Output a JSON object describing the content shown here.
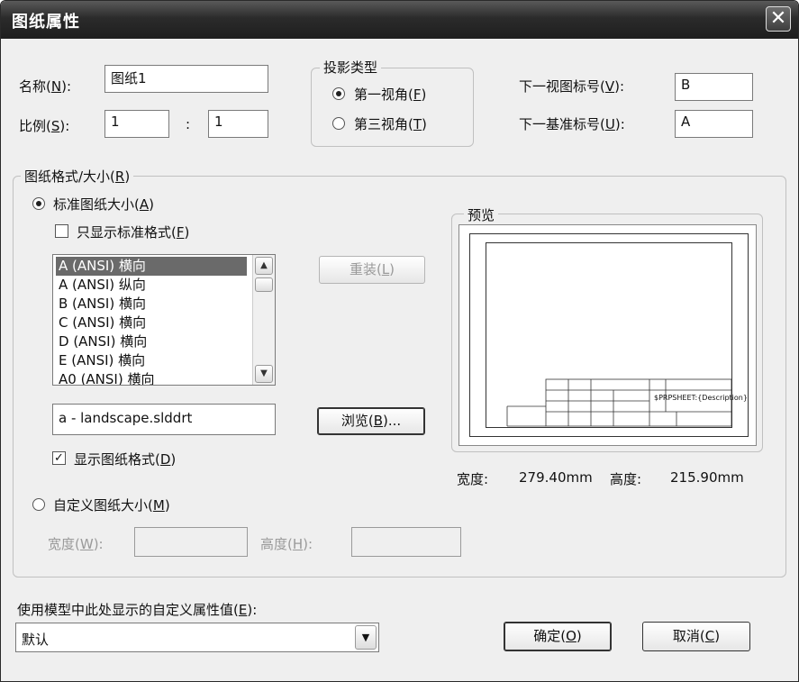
{
  "window": {
    "title": "图纸属性",
    "close_glyph": "✕"
  },
  "name": {
    "label": "名称(",
    "mnemonic": "N",
    "label_end": "):",
    "value": "图纸1"
  },
  "scale": {
    "label": "比例(",
    "mnemonic": "S",
    "label_end": "):",
    "value1": "1",
    "separator": ":",
    "value2": "1"
  },
  "projection": {
    "title": "投影类型",
    "first": {
      "label": "第一视角(",
      "mnemonic": "F",
      "end": ")",
      "selected": true
    },
    "third": {
      "label": "第三视角(",
      "mnemonic": "T",
      "end": ")",
      "selected": false
    }
  },
  "next_view": {
    "label": "下一视图标号(",
    "mnemonic": "V",
    "label_end": "):",
    "value": "B"
  },
  "next_datum": {
    "label": "下一基准标号(",
    "mnemonic": "U",
    "label_end": "):",
    "value": "A"
  },
  "format_group": {
    "title": "图纸格式/大小(",
    "mnemonic": "R",
    "end": ")"
  },
  "standard_size": {
    "label": "标准图纸大小(",
    "mnemonic": "A",
    "end": ")",
    "selected": true
  },
  "only_standard": {
    "label": "只显示标准格式(",
    "mnemonic": "F",
    "end": ")",
    "checked": false
  },
  "size_list": [
    "A (ANSI) 横向",
    "A (ANSI) 纵向",
    "B (ANSI) 横向",
    "C (ANSI) 横向",
    "D (ANSI) 横向",
    "E (ANSI) 横向",
    "A0 (ANSI) 横向"
  ],
  "reload_button": {
    "label": "重装(",
    "mnemonic": "L",
    "end": ")"
  },
  "format_file": {
    "value": "a - landscape.slddrt"
  },
  "browse_button": {
    "label": "浏览(",
    "mnemonic": "B",
    "end": ")..."
  },
  "show_format": {
    "label": "显示图纸格式(",
    "mnemonic": "D",
    "end": ")",
    "checked": true
  },
  "custom_size": {
    "label": "自定义图纸大小(",
    "mnemonic": "M",
    "end": ")",
    "selected": false
  },
  "custom_width": {
    "label": "宽度(",
    "mnemonic": "W",
    "end": "):",
    "value": ""
  },
  "custom_height": {
    "label": "高度(",
    "mnemonic": "H",
    "end": "):",
    "value": ""
  },
  "preview": {
    "title": "预览",
    "title_block_text": "$PRPSHEET:{Description}",
    "width_label": "宽度:",
    "width_value": "279.40mm",
    "height_label": "高度:",
    "height_value": "215.90mm"
  },
  "custom_props": {
    "label": "使用模型中此处显示的自定义属性值(",
    "mnemonic": "E",
    "end": "):",
    "value": "默认"
  },
  "ok_button": {
    "label": "确定(",
    "mnemonic": "O",
    "end": ")"
  },
  "cancel_button": {
    "label": "取消(",
    "mnemonic": "C",
    "end": ")"
  },
  "icons": {
    "scroll_up": "▲",
    "scroll_down": "▼",
    "combo_down": "▼",
    "check": "✓"
  }
}
